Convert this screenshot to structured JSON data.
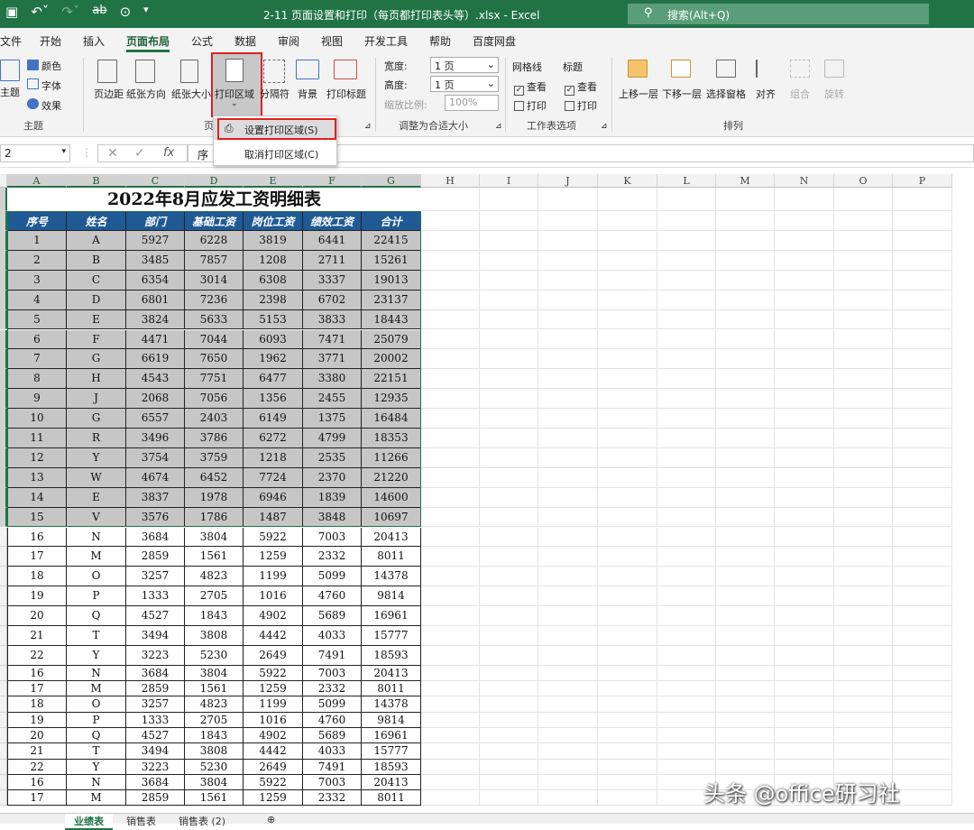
{
  "window": {
    "title": "2-11 页面设置和打印（每页都打印表头等）.xlsx  -  Excel",
    "search_placeholder": "搜索(Alt+Q)"
  },
  "tabs": [
    "文件",
    "开始",
    "插入",
    "页面布局",
    "公式",
    "数据",
    "审阅",
    "视图",
    "开发工具",
    "帮助",
    "百度网盘"
  ],
  "active_tab": "页面布局",
  "ribbon": {
    "theme_label": "主题",
    "colors_label": "颜色",
    "fonts_label": "字体",
    "effects_label": "效果",
    "margins": "页边距",
    "orientation": "纸张方向",
    "size": "纸张大小",
    "print_area": "打印区域",
    "breaks": "分隔符",
    "background": "背景",
    "print_titles": "打印标题",
    "width_label": "宽度:",
    "width_value": "1 页",
    "height_label": "高度:",
    "height_value": "1 页",
    "scale_label": "缩放比例:",
    "scale_value": "100%",
    "gridlines": "网格线",
    "headings": "标题",
    "view": "查看",
    "print": "打印",
    "bring_forward": "上移一层",
    "send_backward": "下移一层",
    "selection_pane": "选择窗格",
    "align": "对齐",
    "group": "组合",
    "rotate": "旋转",
    "group_theme": "主题",
    "group_page": "页",
    "group_scale": "调整为合适大小",
    "group_sheet": "工作表选项",
    "group_arrange": "排列"
  },
  "print_area_menu": {
    "set": "设置打印区域(S)",
    "clear": "取消打印区域(C)"
  },
  "formula_bar": {
    "name_box": "2",
    "content": "序"
  },
  "columns": [
    "A",
    "B",
    "C",
    "D",
    "E",
    "F",
    "G",
    "H",
    "I",
    "J",
    "K",
    "L",
    "M",
    "N",
    "O",
    "P"
  ],
  "sheet": {
    "title": "2022年8月应发工资明细表",
    "headers": [
      "序号",
      "姓名",
      "部门",
      "基础工资",
      "岗位工资",
      "绩效工资",
      "合计"
    ],
    "rows": [
      [
        "1",
        "A",
        "5927",
        "6228",
        "3819",
        "6441",
        "22415"
      ],
      [
        "2",
        "B",
        "3485",
        "7857",
        "1208",
        "2711",
        "15261"
      ],
      [
        "3",
        "C",
        "6354",
        "3014",
        "6308",
        "3337",
        "19013"
      ],
      [
        "4",
        "D",
        "6801",
        "7236",
        "2398",
        "6702",
        "23137"
      ],
      [
        "5",
        "E",
        "3824",
        "5633",
        "5153",
        "3833",
        "18443"
      ],
      [
        "6",
        "F",
        "4471",
        "7044",
        "6093",
        "7471",
        "25079"
      ],
      [
        "7",
        "G",
        "6619",
        "7650",
        "1962",
        "3771",
        "20002"
      ],
      [
        "8",
        "H",
        "4543",
        "7751",
        "6477",
        "3380",
        "22151"
      ],
      [
        "9",
        "J",
        "2068",
        "7056",
        "1356",
        "2455",
        "12935"
      ],
      [
        "10",
        "G",
        "6557",
        "2403",
        "6149",
        "1375",
        "16484"
      ],
      [
        "11",
        "R",
        "3496",
        "3786",
        "6272",
        "4799",
        "18353"
      ],
      [
        "12",
        "Y",
        "3754",
        "3759",
        "1218",
        "2535",
        "11266"
      ],
      [
        "13",
        "W",
        "4674",
        "6452",
        "7724",
        "2370",
        "21220"
      ],
      [
        "14",
        "E",
        "3837",
        "1978",
        "6946",
        "1839",
        "14600"
      ],
      [
        "15",
        "V",
        "3576",
        "1786",
        "1487",
        "3848",
        "10697"
      ],
      [
        "16",
        "N",
        "3684",
        "3804",
        "5922",
        "7003",
        "20413"
      ],
      [
        "17",
        "M",
        "2859",
        "1561",
        "1259",
        "2332",
        "8011"
      ],
      [
        "18",
        "O",
        "3257",
        "4823",
        "1199",
        "5099",
        "14378"
      ],
      [
        "19",
        "P",
        "1333",
        "2705",
        "1016",
        "4760",
        "9814"
      ],
      [
        "20",
        "Q",
        "4527",
        "1843",
        "4902",
        "5689",
        "16961"
      ],
      [
        "21",
        "T",
        "3494",
        "3808",
        "4442",
        "4033",
        "15777"
      ],
      [
        "22",
        "Y",
        "3223",
        "5230",
        "2649",
        "7491",
        "18593"
      ],
      [
        "16",
        "N",
        "3684",
        "3804",
        "5922",
        "7003",
        "20413"
      ],
      [
        "17",
        "M",
        "2859",
        "1561",
        "1259",
        "2332",
        "8011"
      ],
      [
        "18",
        "O",
        "3257",
        "4823",
        "1199",
        "5099",
        "14378"
      ],
      [
        "19",
        "P",
        "1333",
        "2705",
        "1016",
        "4760",
        "9814"
      ],
      [
        "20",
        "Q",
        "4527",
        "1843",
        "4902",
        "5689",
        "16961"
      ],
      [
        "21",
        "T",
        "3494",
        "3808",
        "4442",
        "4033",
        "15777"
      ],
      [
        "22",
        "Y",
        "3223",
        "5230",
        "2649",
        "7491",
        "18593"
      ],
      [
        "16",
        "N",
        "3684",
        "3804",
        "5922",
        "7003",
        "20413"
      ],
      [
        "17",
        "M",
        "2859",
        "1561",
        "1259",
        "2332",
        "8011"
      ]
    ]
  },
  "sheet_tabs": [
    "业绩表",
    "销售表",
    "销售表 (2)"
  ],
  "active_sheet": "业绩表",
  "watermark": "头条 @office研习社",
  "colors": {
    "accent": "#217346",
    "header_fill": "#1f5a94",
    "selected_fill": "#c6c6c6",
    "highlight": "#e02020"
  }
}
